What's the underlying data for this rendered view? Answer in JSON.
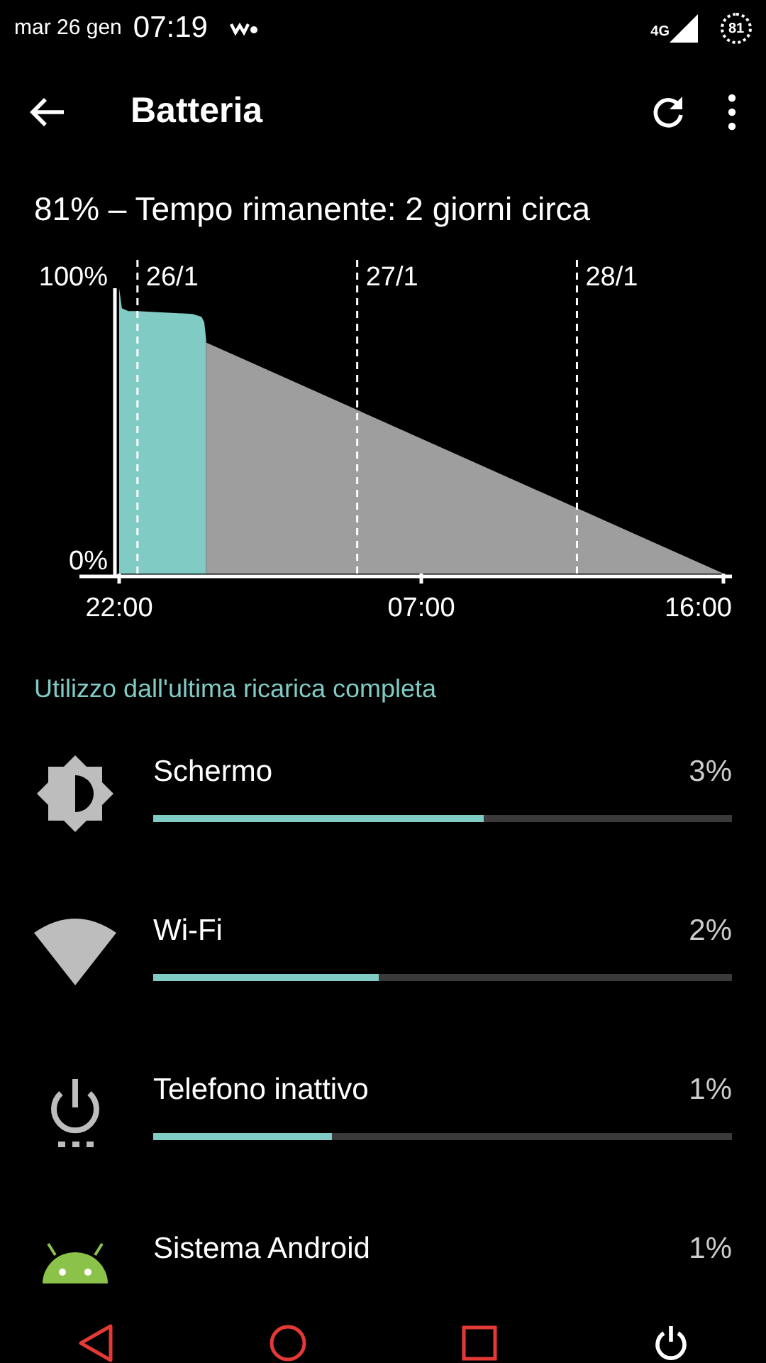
{
  "status_bar": {
    "date": "mar 26 gen",
    "time": "07:19",
    "network": "4G",
    "battery": "81"
  },
  "app_bar": {
    "title": "Batteria"
  },
  "summary": "81% – Tempo rimanente: 2 giorni circa",
  "history": {
    "y_labels": [
      "100%",
      "0%"
    ],
    "date_labels": [
      "26/1",
      "27/1",
      "28/1"
    ],
    "time_labels": [
      "22:00",
      "07:00",
      "16:00"
    ]
  },
  "usage": {
    "header": "Utilizzo dall'ultima ricarica completa",
    "items": [
      {
        "kind": "screen",
        "name": "Schermo",
        "percent": "3%",
        "level": 0.57
      },
      {
        "kind": "wifi",
        "name": "Wi-Fi",
        "percent": "2%",
        "level": 0.39
      },
      {
        "kind": "idle",
        "name": "Telefono inattivo",
        "percent": "1%",
        "level": 0.31
      },
      {
        "kind": "android",
        "name": "Sistema Android",
        "percent": "1%"
      }
    ]
  }
}
